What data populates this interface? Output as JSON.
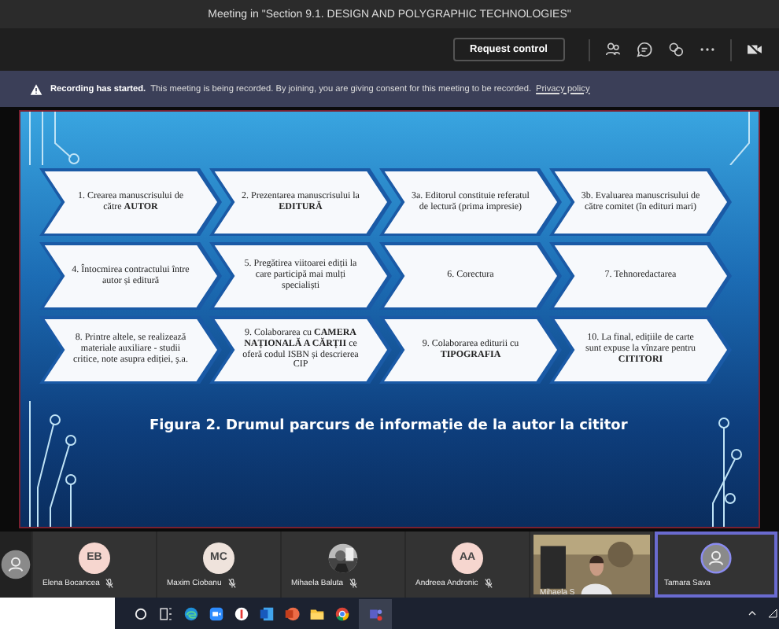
{
  "window": {
    "title": "Meeting in \"Section 9.1. DESIGN AND POLYGRAPHIC TECHNOLOGIES\""
  },
  "toolbar": {
    "request_control": "Request control"
  },
  "banner": {
    "title": "Recording has started.",
    "message": "This meeting is being recorded. By joining, you are giving consent for this meeting to be recorded.",
    "link": "Privacy policy"
  },
  "slide": {
    "rows": [
      [
        "1. Crearea manuscrisului de către **AUTOR**",
        "2. Prezentarea manuscrisului la **EDITURĂ**",
        "3a. Editorul constituie referatul de lectură (prima impresie)",
        "3b. Evaluarea manuscrisului de către comitet (în edituri mari)"
      ],
      [
        "4. Întocmirea contractului între autor și editură",
        "5. Pregătirea viitoarei ediții la care participă mai mulți specialiști",
        "6. Corectura",
        "7. Tehnoredactarea"
      ],
      [
        "8. Printre altele, se realizează materiale auxiliare - studii critice, note asupra ediției, ş.a.",
        "9. Colaborarea cu **CAMERA NAȚIONALĂ A CĂRȚII** ce oferă codul ISBN și descrierea CIP",
        "9. Colaborarea editurii cu **TIPOGRAFIA**",
        "10. La final, edițiile de carte sunt expuse la vînzare pentru **CITITORI**"
      ]
    ],
    "caption": "Figura 2. Drumul parcurs de informație de la autor la cititor"
  },
  "participants": [
    {
      "kind": "icon",
      "speaking": false
    },
    {
      "kind": "initials",
      "initials": "EB",
      "name": "Elena Bocancea",
      "muted": true,
      "speaking": false
    },
    {
      "kind": "initials",
      "initials": "MC",
      "name": "Maxim Ciobanu",
      "muted": true,
      "speaking": false
    },
    {
      "name": "Mihaela Baluta",
      "muted": true,
      "speaking": false
    },
    {
      "kind": "initials",
      "initials": "AA",
      "name": "Andreea Andronic",
      "muted": true,
      "speaking": false
    },
    {
      "kind": "video",
      "name": "Mihaela S",
      "muted": false,
      "speaking": false
    },
    {
      "kind": "icon",
      "name": "Tamara Sava",
      "muted": false,
      "speaking": true
    }
  ]
}
